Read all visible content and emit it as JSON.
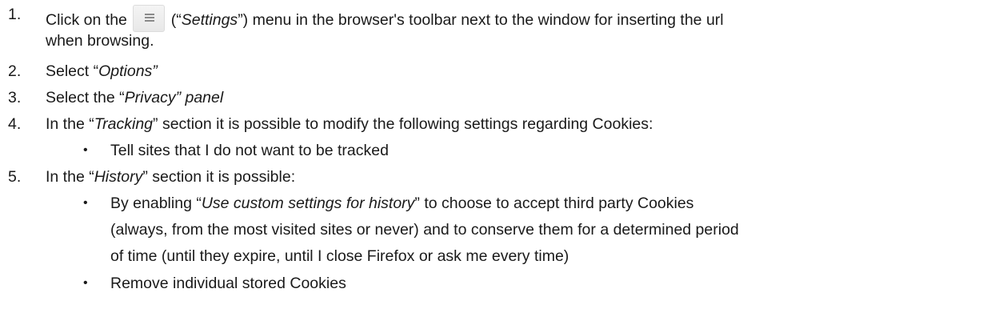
{
  "steps": [
    {
      "number": "1.",
      "before_icon": "Click on the ",
      "icon": "menu-icon",
      "after_icon_open": " (“",
      "after_icon_italic": "Settings",
      "after_icon_rest": "”) menu in the browser's toolbar next to the window for inserting the url",
      "continuation": "when browsing."
    },
    {
      "number": "2.",
      "text_before": "Select “",
      "text_italic": "Options”"
    },
    {
      "number": "3.",
      "text_before": "Select the “",
      "text_italic": "Privacy” panel"
    },
    {
      "number": "4.",
      "text_before": "In the “",
      "text_italic": "Tracking",
      "text_after": "” section it is possible to modify the following settings regarding Cookies:",
      "bullets": [
        {
          "text": "Tell sites that I do not want to be tracked"
        }
      ]
    },
    {
      "number": "5.",
      "text_before": "In the “",
      "text_italic": "History",
      "text_after": "” section it is possible:",
      "bullets": [
        {
          "before": "By enabling “",
          "italic": "Use custom settings for history",
          "after": "” to choose to accept third party Cookies",
          "line2": "(always, from the most visited sites or never) and to conserve them for a determined period",
          "line3": "of time (until they expire, until I close Firefox or ask me every time)"
        },
        {
          "text": "Remove individual stored Cookies"
        }
      ]
    }
  ],
  "bullet_symbol": "•"
}
